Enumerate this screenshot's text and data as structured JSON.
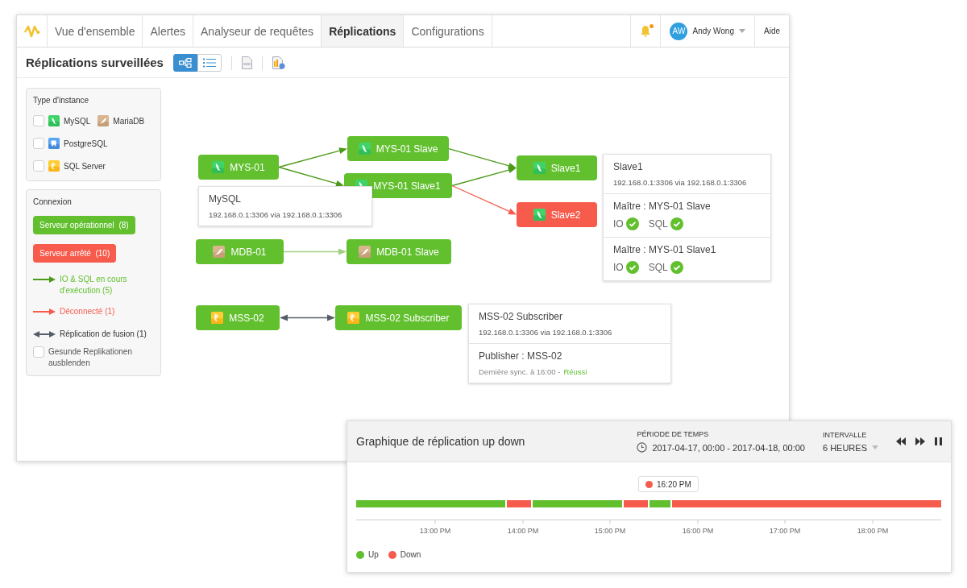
{
  "nav": {
    "tabs": [
      {
        "label": "Vue d'ensemble",
        "selected": false
      },
      {
        "label": "Alertes",
        "selected": false
      },
      {
        "label": "Analyseur de requêtes",
        "selected": false
      },
      {
        "label": "Réplications",
        "selected": true
      },
      {
        "label": "Configurations",
        "selected": false
      }
    ],
    "notifications": {
      "unread": true
    },
    "user": {
      "initials": "AW",
      "name": "Andy Wong"
    },
    "help": "Aide"
  },
  "toolbar": {
    "title": "Réplications surveillées",
    "views": [
      {
        "kind": "diagram",
        "selected": true
      },
      {
        "kind": "list",
        "selected": false
      }
    ],
    "actions": [
      {
        "kind": "pdf"
      },
      {
        "kind": "export"
      }
    ]
  },
  "filters": {
    "title": "Type d'instance",
    "rows": [
      {
        "checked": false,
        "items": [
          {
            "kind": "mysql",
            "label": "MySQL"
          },
          {
            "kind": "mariadb",
            "label": "MariaDB"
          }
        ]
      },
      {
        "checked": false,
        "items": [
          {
            "kind": "postgres",
            "label": "PostgreSQL"
          }
        ]
      },
      {
        "checked": false,
        "items": [
          {
            "kind": "sqlserver",
            "label": "SQL Server"
          }
        ]
      }
    ]
  },
  "connection": {
    "title": "Connexion",
    "badges": [
      {
        "kind": "up",
        "label": "Serveur opérationnel  (8)"
      },
      {
        "kind": "down",
        "label": "Serveur arrêté  (10)"
      }
    ],
    "legend": [
      {
        "kind": "running",
        "label": "IO & SQL en cours d'exécution (5)"
      },
      {
        "kind": "disconnected",
        "label": "Déconnecté (1)"
      },
      {
        "kind": "merge",
        "label": "Réplication de fusion (1)"
      }
    ],
    "hide_healthy": {
      "label": "Gesunde Replikationen ausblenden",
      "checked": false
    }
  },
  "diagram": {
    "nodes": [
      {
        "label": "MYS-01",
        "kind": "mysql",
        "online": true
      },
      {
        "label": "MYS-01 Slave",
        "kind": "mysql",
        "online": true
      },
      {
        "label": "MYS-01 Slave1",
        "kind": "mysql",
        "online": true
      },
      {
        "label": "Slave1",
        "kind": "mysql",
        "online": true
      },
      {
        "label": "Slave2",
        "kind": "mysql",
        "online": false
      },
      {
        "label": "MDB-01",
        "kind": "mariadb",
        "online": true
      },
      {
        "label": "MDB-01 Slave",
        "kind": "mariadb",
        "online": true
      },
      {
        "label": "MSS-02",
        "kind": "sqlserver",
        "online": true
      },
      {
        "label": "MSS-02 Subscriber",
        "kind": "sqlserver",
        "online": true
      }
    ],
    "edges": [
      {
        "kind": "running"
      },
      {
        "kind": "running"
      },
      {
        "kind": "running"
      },
      {
        "kind": "running"
      },
      {
        "kind": "disconnected"
      },
      {
        "kind": "idle"
      },
      {
        "kind": "merge"
      }
    ],
    "cards": [
      {
        "sections": [
          {
            "kind": "header",
            "title": "MySQL",
            "address": "192.168.0.1:3306 via 192.168.0.1:3306"
          }
        ]
      },
      {
        "sections": [
          {
            "kind": "header",
            "title": "Slave1",
            "address": "192.168.0.1:3306 via 192.168.0.1:3306"
          },
          {
            "kind": "master",
            "title": "Maître : MYS-01 Slave",
            "checks": [
              {
                "label": "IO",
                "ok": true
              },
              {
                "label": "SQL",
                "ok": true
              }
            ]
          },
          {
            "kind": "master",
            "title": "Maître : MYS-01 Slave1",
            "checks": [
              {
                "label": "IO",
                "ok": true
              },
              {
                "label": "SQL",
                "ok": true
              }
            ]
          }
        ]
      },
      {
        "sections": [
          {
            "kind": "header",
            "title": "MSS-02 Subscriber",
            "address": "192.168.0.1:3306 via 192.168.0.1:3306"
          },
          {
            "kind": "sync",
            "title": "Publisher : MSS-02",
            "note": "Dernière sync. à 16:00 -",
            "result": "Réussi"
          }
        ]
      }
    ]
  },
  "timeline": {
    "title": "Graphique de réplication up down",
    "period_label": "PÉRIODE DE TEMPS",
    "period": "2017-04-17, 00:00 - 2017-04-18, 00:00",
    "interval_label": "INTERVALLE",
    "interval": "6 HEURES",
    "controls": [
      {
        "kind": "rewind"
      },
      {
        "kind": "forward"
      },
      {
        "kind": "pause"
      }
    ],
    "marker": {
      "label": "16:20 PM",
      "up": false
    },
    "segments": [
      {
        "up": true
      },
      {
        "up": false
      },
      {
        "up": true
      },
      {
        "up": false
      },
      {
        "up": true
      },
      {
        "up": false
      }
    ],
    "ticks": [
      "13:00 PM",
      "14:00 PM",
      "15:00 PM",
      "16:00 PM",
      "17:00 PM",
      "18:00 PM"
    ],
    "legend": [
      {
        "label": "Up",
        "color": "#5fbf2e"
      },
      {
        "label": "Down",
        "color": "#f65b4c"
      }
    ]
  }
}
